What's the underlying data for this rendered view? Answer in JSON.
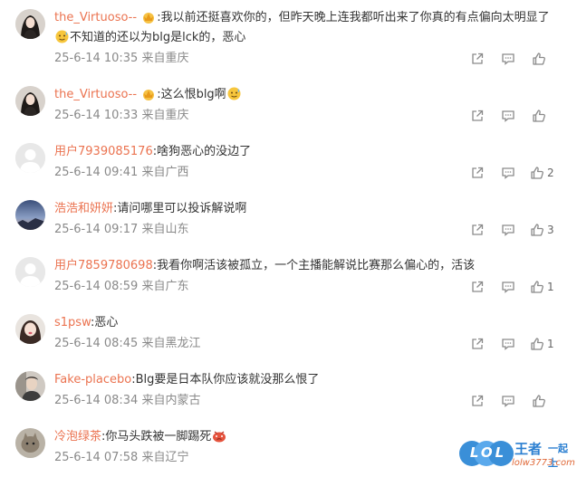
{
  "comments": [
    {
      "username": "the_Virtuoso--",
      "text1": ":我以前还挺喜欢你的，但昨天晚上连我都听出来了你真的有点偏向太明显了",
      "text2": "不知道的还以为blg是lck的，恶心",
      "date": "25-6-14 10:35",
      "location": "来自重庆",
      "likes": "",
      "avatar": "woman-photo",
      "badge": "crown-badge-icon",
      "emoji": "sweat-emoji-icon"
    },
    {
      "username": "the_Virtuoso--",
      "text1": ":这么恨blg啊",
      "date": "25-6-14 10:33",
      "location": "来自重庆",
      "likes": "",
      "avatar": "woman-photo",
      "badge": "crown-badge-icon",
      "emoji": "sweat-emoji-icon"
    },
    {
      "username": "用户7939085176",
      "text1": ":啥狗恶心的没边了",
      "date": "25-6-14 09:41",
      "location": "来自广西",
      "likes": "2",
      "avatar": "default-avatar"
    },
    {
      "username": "浩浩和妍妍",
      "text1": ":请问哪里可以投诉解说啊",
      "date": "25-6-14 09:17",
      "location": "来自山东",
      "likes": "3",
      "avatar": "sky-photo"
    },
    {
      "username": "用户7859780698",
      "text1": ":我看你啊活该被孤立，一个主播能解说比赛那么偏心的，活该",
      "date": "25-6-14 08:59",
      "location": "来自广东",
      "likes": "1",
      "avatar": "default-avatar"
    },
    {
      "username": "s1psw",
      "text1": ":恶心",
      "date": "25-6-14 08:45",
      "location": "来自黑龙江",
      "likes": "1",
      "avatar": "girl-photo"
    },
    {
      "username": "Fake-placebo",
      "text1": ":Blg要是日本队你应该就没那么恨了",
      "date": "25-6-14 08:34",
      "location": "来自内蒙古",
      "likes": "",
      "avatar": "man-photo"
    },
    {
      "username": "冷泡绿茶",
      "text1": ":你马头跌被一脚踢死",
      "date": "25-6-14 07:58",
      "location": "来自辽宁",
      "likes": "",
      "avatar": "cat-photo",
      "emoji": "angry-emoji-icon"
    }
  ],
  "watermark": {
    "logo": "LOL",
    "line1": "王者",
    "line2": "一起上",
    "url": "lolw3773.com"
  },
  "colors": {
    "username": "#eb7350",
    "text": "#333333",
    "meta": "#8a8a8a",
    "icon": "#8a8a8a"
  }
}
